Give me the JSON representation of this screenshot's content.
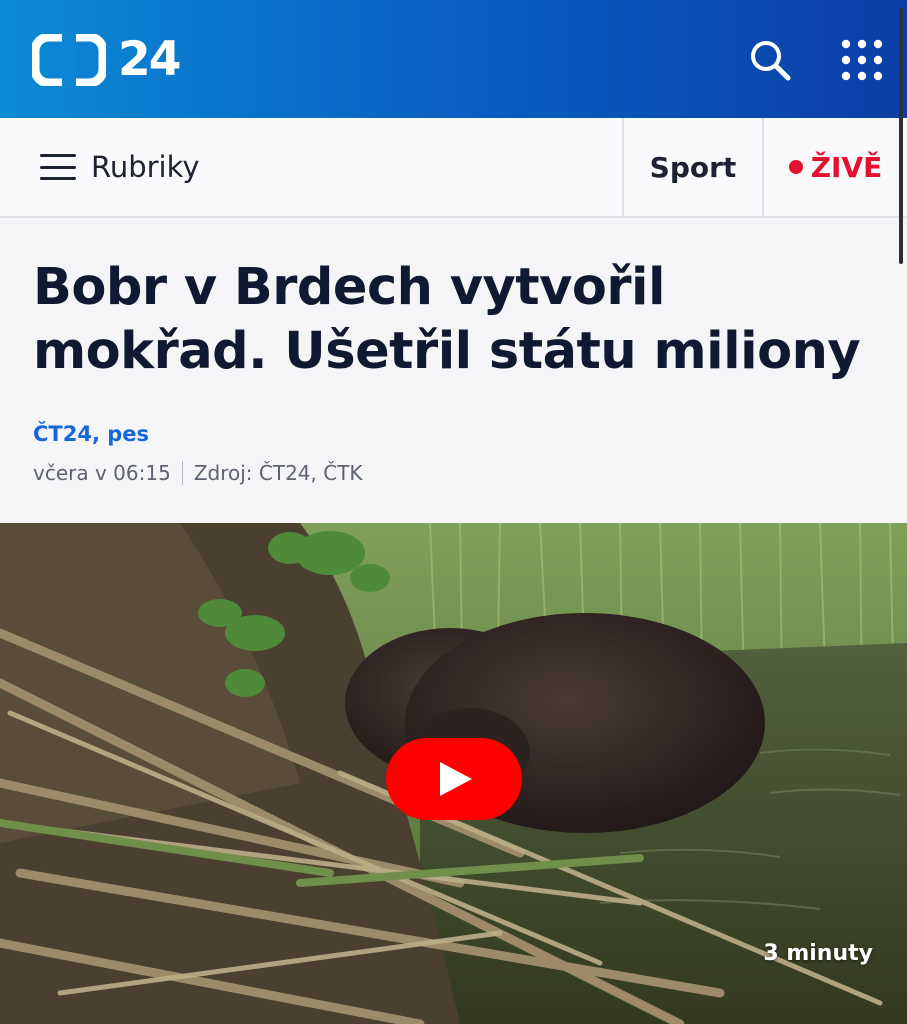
{
  "header": {
    "logo_text": "24",
    "logo_alt": "ČT24 logo",
    "brand_gradient": [
      "#0b8ad6",
      "#0b3fa6"
    ]
  },
  "nav": {
    "menu_label": "Rubriky",
    "sport_label": "Sport",
    "live_label": "ŽIVĚ",
    "live_color": "#e3102e"
  },
  "article": {
    "title": "Bobr v Brdech vytvořil mokřad. Ušetřil státu miliony",
    "tags": "ČT24, pes",
    "date": "včera v 06:15",
    "source": "Zdroj: ČT24, ČTK",
    "tag_color": "#1668d8"
  },
  "video": {
    "duration": "3 minuty",
    "play_color": "#ff0000"
  },
  "icons": [
    "ct-logo-icon",
    "search-icon",
    "apps-grid-icon",
    "menu-icon",
    "live-dot-icon",
    "play-icon"
  ]
}
